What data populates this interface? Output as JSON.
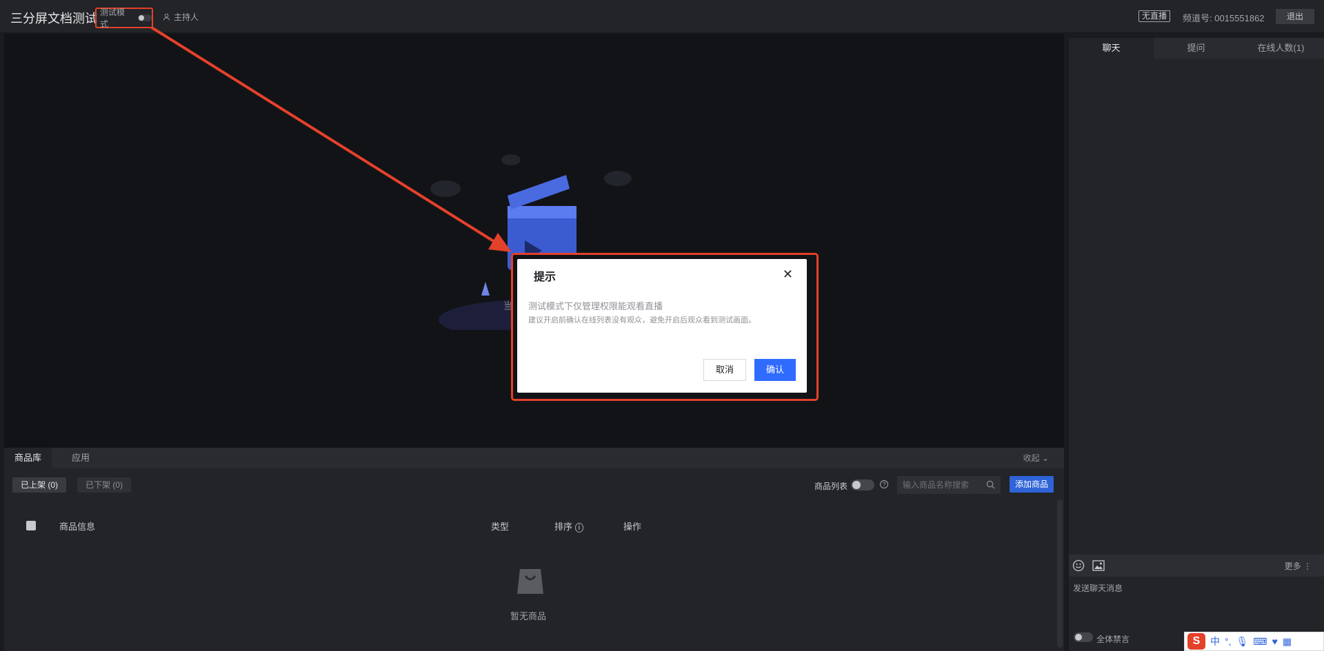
{
  "header": {
    "app_title": "三分屏文档测试",
    "test_mode_label": "测试模式",
    "role": "主持人",
    "live_status": "无直播",
    "channel_label": "频道号: 0015551862",
    "logout_label": "退出"
  },
  "stage": {
    "status_text": "当"
  },
  "products": {
    "tabs": [
      {
        "label": "商品库"
      },
      {
        "label": "应用"
      }
    ],
    "collapse_label": "收起",
    "filter_on_shelf": "已上架 (0)",
    "filter_off_shelf": "已下架 (0)",
    "product_list_label": "商品列表",
    "search_placeholder": "输入商品名称搜索",
    "add_label": "添加商品",
    "columns": {
      "info": "商品信息",
      "type": "类型",
      "sort": "排序",
      "action": "操作"
    },
    "empty_text": "暂无商品"
  },
  "chat": {
    "tabs": [
      {
        "label": "聊天"
      },
      {
        "label": "提问"
      },
      {
        "label": "在线人数(1)"
      }
    ],
    "more_label": "更多",
    "input_placeholder": "发送聊天消息",
    "mute_all_label": "全体禁言"
  },
  "ime": {
    "mode": "中"
  },
  "dialog": {
    "title": "提示",
    "message": "测试模式下仅管理权限能观看直播",
    "sub_message": "建议开启前确认在线列表没有观众，避免开启后观众看到测试画面。",
    "cancel_label": "取消",
    "confirm_label": "确认"
  },
  "colors": {
    "accent": "#2f6bff",
    "highlight": "#e4412b",
    "background": "#1a1b1f"
  }
}
